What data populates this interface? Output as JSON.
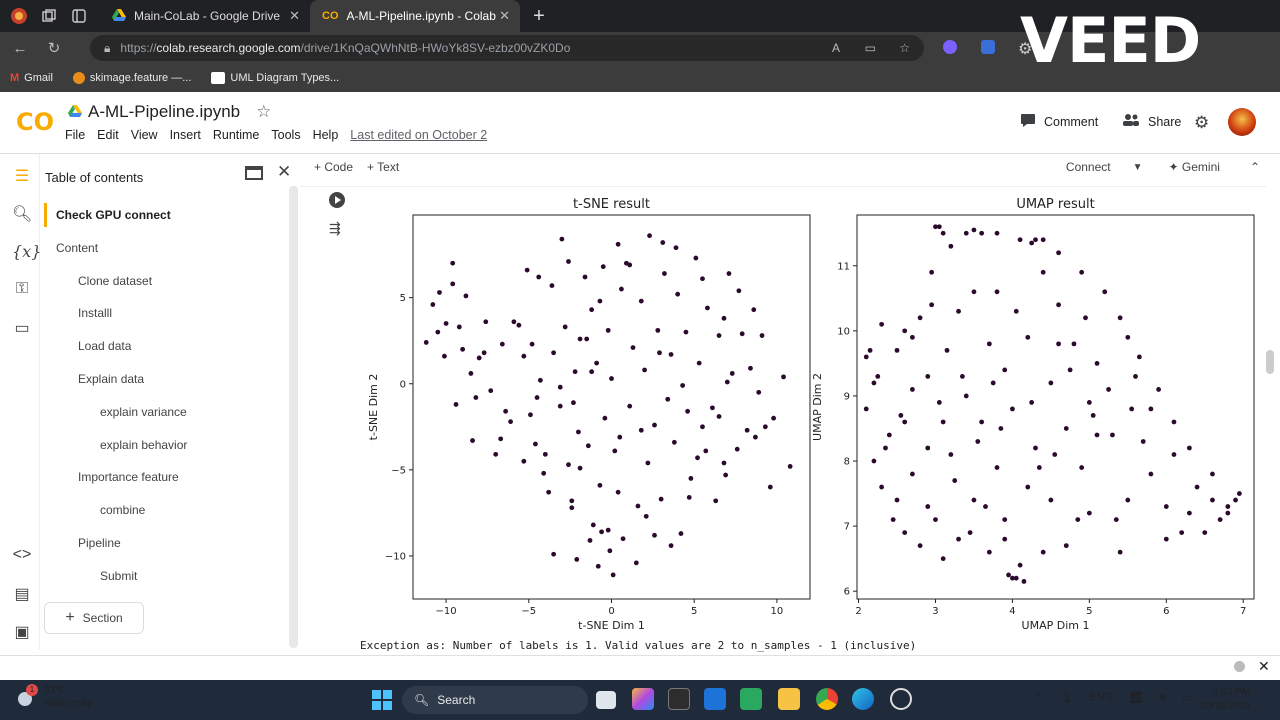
{
  "browser": {
    "tabs": [
      {
        "label": "Main-CoLab - Google Drive"
      },
      {
        "label": "A-ML-Pipeline.ipynb - Colab"
      }
    ],
    "url_prefix": "https://",
    "url_domain": "colab.research.google.com",
    "url_path": "/drive/1KnQaQWhNtB-HWoYk8SV-ezbz00vZK0Do",
    "bookmarks": [
      {
        "label": "Gmail"
      },
      {
        "label": "skimage.feature —..."
      },
      {
        "label": "UML Diagram Types..."
      }
    ],
    "watermark": "VEED"
  },
  "colab": {
    "logo": "CO",
    "notebook_title": "A-ML-Pipeline.ipynb",
    "menus": [
      "File",
      "Edit",
      "View",
      "Insert",
      "Runtime",
      "Tools",
      "Help"
    ],
    "last_edited": "Last edited on October 2",
    "comment_label": "Comment",
    "share_label": "Share",
    "toolbar": {
      "code_label": "Code",
      "text_label": "Text",
      "connect_label": "Connect",
      "gemini_label": "Gemini"
    }
  },
  "toc": {
    "title": "Table of contents",
    "items": [
      {
        "label": "Check GPU connect",
        "level": 1,
        "active": true
      },
      {
        "label": "Content",
        "level": 1
      },
      {
        "label": "Clone dataset",
        "level": 2
      },
      {
        "label": "Installl",
        "level": 2
      },
      {
        "label": "Load data",
        "level": 2
      },
      {
        "label": "Explain data",
        "level": 2
      },
      {
        "label": "explain variance",
        "level": 3
      },
      {
        "label": "explain behavior",
        "level": 3
      },
      {
        "label": "Importance feature",
        "level": 2
      },
      {
        "label": "combine",
        "level": 3
      },
      {
        "label": "Pipeline",
        "level": 2
      },
      {
        "label": "Submit",
        "level": 3
      }
    ],
    "section_button": "Section"
  },
  "output": {
    "exception": "Exception as: Number of labels is 1. Valid values are 2 to n_samples - 1 (inclusive)"
  },
  "chart_data": [
    {
      "type": "scatter",
      "title": "t-SNE result",
      "xlabel": "t-SNE Dim 1",
      "ylabel": "t-SNE Dim 2",
      "xlim": [
        -12,
        12
      ],
      "ylim": [
        -12.5,
        9.8
      ],
      "xticks": [
        -10,
        -5,
        0,
        5,
        10
      ],
      "yticks": [
        -10,
        -5,
        0,
        5
      ],
      "color": "#2c0a2e",
      "points": [
        [
          -11.2,
          2.4
        ],
        [
          -10.8,
          4.6
        ],
        [
          -10.5,
          3
        ],
        [
          -10.4,
          5.3
        ],
        [
          -10,
          3.5
        ],
        [
          -9.6,
          5.8
        ],
        [
          -9.6,
          7
        ],
        [
          -9.2,
          3.3
        ],
        [
          -9,
          2
        ],
        [
          -8.8,
          5.1
        ],
        [
          -8.5,
          0.6
        ],
        [
          -8.2,
          -0.8
        ],
        [
          -8,
          1.5
        ],
        [
          -7.6,
          3.6
        ],
        [
          -7.3,
          -0.4
        ],
        [
          -7,
          -4.1
        ],
        [
          -6.6,
          2.3
        ],
        [
          -6.1,
          -2.2
        ],
        [
          -5.9,
          3.6
        ],
        [
          -5.6,
          3.4
        ],
        [
          -5.3,
          1.6
        ],
        [
          -5.1,
          6.6
        ],
        [
          -4.9,
          -1.8
        ],
        [
          -4.6,
          -3.5
        ],
        [
          -4.3,
          0.2
        ],
        [
          -4.1,
          -5.2
        ],
        [
          -3.8,
          -6.3
        ],
        [
          -3.5,
          1.8
        ],
        [
          -3.1,
          -1.3
        ],
        [
          -3,
          8.4
        ],
        [
          -2.8,
          3.3
        ],
        [
          -2.6,
          -4.7
        ],
        [
          -2.4,
          -6.8
        ],
        [
          -2.2,
          0.7
        ],
        [
          -2,
          -2.8
        ],
        [
          -1.9,
          2.6
        ],
        [
          -1.6,
          6.2
        ],
        [
          -1.4,
          -3.6
        ],
        [
          -1.2,
          4.3
        ],
        [
          -1.1,
          -8.2
        ],
        [
          -0.9,
          1.2
        ],
        [
          -0.7,
          -5.9
        ],
        [
          -0.6,
          -8.6
        ],
        [
          -0.4,
          -2
        ],
        [
          -0.2,
          3.1
        ],
        [
          0,
          0.3
        ],
        [
          0.2,
          -3.9
        ],
        [
          0.4,
          -6.3
        ],
        [
          0.6,
          5.5
        ],
        [
          0.7,
          -9
        ],
        [
          0.9,
          7
        ],
        [
          1.1,
          -1.3
        ],
        [
          1.3,
          2.1
        ],
        [
          1.6,
          -7.1
        ],
        [
          1.8,
          4.8
        ],
        [
          2,
          0.8
        ],
        [
          2.2,
          -4.6
        ],
        [
          2.3,
          8.6
        ],
        [
          2.6,
          -2.4
        ],
        [
          2.8,
          3.1
        ],
        [
          3,
          -6.7
        ],
        [
          3.2,
          6.4
        ],
        [
          3.4,
          -0.9
        ],
        [
          3.6,
          1.7
        ],
        [
          3.8,
          -3.4
        ],
        [
          4,
          5.2
        ],
        [
          4.2,
          -8.7
        ],
        [
          4.3,
          -0.1
        ],
        [
          4.5,
          3
        ],
        [
          4.8,
          -5.5
        ],
        [
          5.1,
          7.3
        ],
        [
          5.3,
          1.2
        ],
        [
          5.5,
          -2.5
        ],
        [
          5.8,
          4.4
        ],
        [
          6.1,
          -1.4
        ],
        [
          6.3,
          -6.8
        ],
        [
          6.5,
          2.8
        ],
        [
          6.8,
          -4.6
        ],
        [
          7.1,
          6.4
        ],
        [
          7.3,
          0.6
        ],
        [
          7.6,
          -3.8
        ],
        [
          7.9,
          2.9
        ],
        [
          8.2,
          -2.7
        ],
        [
          8.6,
          4.3
        ],
        [
          8.9,
          -0.5
        ],
        [
          9.3,
          -2.5
        ],
        [
          9.6,
          -6
        ],
        [
          9.8,
          -2
        ],
        [
          10.4,
          0.4
        ],
        [
          10.8,
          -4.8
        ],
        [
          -9.4,
          -1.2
        ],
        [
          -3.5,
          -9.9
        ],
        [
          -2.1,
          -10.2
        ],
        [
          0.1,
          -11.1
        ],
        [
          1.5,
          -10.4
        ],
        [
          -0.8,
          -10.6
        ],
        [
          3.6,
          -9.4
        ],
        [
          2.6,
          -8.8
        ],
        [
          -1.3,
          -9.1
        ],
        [
          -0.1,
          -9.7
        ],
        [
          5.7,
          -3.9
        ],
        [
          4.7,
          -6.6
        ],
        [
          6.9,
          -5.3
        ],
        [
          8.4,
          0.9
        ],
        [
          -6.7,
          -3.2
        ],
        [
          -4.5,
          -0.8
        ],
        [
          -2.3,
          -1.1
        ],
        [
          -3.6,
          5.7
        ],
        [
          -1.9,
          -4.9
        ],
        [
          -0.7,
          4.8
        ],
        [
          1.1,
          6.9
        ],
        [
          3.1,
          8.2
        ],
        [
          -5.3,
          -4.5
        ],
        [
          -4,
          -4.1
        ],
        [
          -1.5,
          2.6
        ],
        [
          1.8,
          -2.7
        ],
        [
          0.5,
          -3.1
        ],
        [
          -3.1,
          -0.2
        ],
        [
          5.5,
          6.1
        ],
        [
          7,
          0.1
        ],
        [
          6.5,
          -1.9
        ],
        [
          -7.7,
          1.8
        ],
        [
          -8.4,
          -3.3
        ],
        [
          -10.1,
          1.6
        ],
        [
          -6.4,
          -1.6
        ],
        [
          -4.8,
          2.3
        ],
        [
          -2.4,
          -7.2
        ],
        [
          -0.2,
          -8.5
        ],
        [
          2.1,
          -7.7
        ],
        [
          -1.2,
          0.7
        ],
        [
          2.9,
          1.8
        ],
        [
          4.6,
          -1.6
        ],
        [
          5.2,
          -4.3
        ],
        [
          8.7,
          -3.1
        ],
        [
          9.1,
          2.8
        ],
        [
          7.7,
          5.4
        ],
        [
          6.8,
          3.8
        ],
        [
          3.9,
          7.9
        ],
        [
          0.4,
          8.1
        ],
        [
          -2.6,
          7.1
        ],
        [
          -4.4,
          6.2
        ],
        [
          -0.5,
          6.8
        ]
      ]
    },
    {
      "type": "scatter",
      "title": "UMAP result",
      "xlabel": "UMAP Dim 1",
      "ylabel": "UMAP Dim 2",
      "xlim": [
        1.98,
        7.14
      ],
      "ylim": [
        5.88,
        11.78
      ],
      "xticks": [
        2,
        3,
        4,
        5,
        6,
        7
      ],
      "yticks": [
        6,
        7,
        8,
        9,
        10,
        11
      ],
      "color": "#2c0a2e",
      "points": [
        [
          2.1,
          9.6
        ],
        [
          2.1,
          8.8
        ],
        [
          2.2,
          9.2
        ],
        [
          2.2,
          8
        ],
        [
          2.3,
          10.1
        ],
        [
          2.3,
          7.6
        ],
        [
          2.4,
          8.4
        ],
        [
          2.5,
          9.7
        ],
        [
          2.5,
          7.4
        ],
        [
          2.6,
          8.6
        ],
        [
          2.6,
          6.9
        ],
        [
          2.7,
          9.1
        ],
        [
          2.7,
          7.8
        ],
        [
          2.8,
          10.2
        ],
        [
          2.8,
          6.7
        ],
        [
          2.9,
          9.3
        ],
        [
          2.9,
          8.2
        ],
        [
          2.95,
          10.9
        ],
        [
          3,
          11.6
        ],
        [
          3,
          7.1
        ],
        [
          3.05,
          8.9
        ],
        [
          3.1,
          11.5
        ],
        [
          3.1,
          6.5
        ],
        [
          3.15,
          9.7
        ],
        [
          3.2,
          11.3
        ],
        [
          3.2,
          8.1
        ],
        [
          3.3,
          10.3
        ],
        [
          3.3,
          6.8
        ],
        [
          3.4,
          11.5
        ],
        [
          3.4,
          9
        ],
        [
          3.5,
          7.4
        ],
        [
          3.5,
          10.6
        ],
        [
          3.6,
          8.6
        ],
        [
          3.6,
          11.5
        ],
        [
          3.7,
          6.6
        ],
        [
          3.7,
          9.8
        ],
        [
          3.8,
          7.9
        ],
        [
          3.8,
          11.5
        ],
        [
          3.9,
          9.4
        ],
        [
          3.9,
          7.1
        ],
        [
          4,
          6.2
        ],
        [
          4,
          8.8
        ],
        [
          4.05,
          10.3
        ],
        [
          4.1,
          11.4
        ],
        [
          4.1,
          6.4
        ],
        [
          4.2,
          7.6
        ],
        [
          4.2,
          9.9
        ],
        [
          4.3,
          11.4
        ],
        [
          4.3,
          8.2
        ],
        [
          4.4,
          6.6
        ],
        [
          4.4,
          11.4
        ],
        [
          4.5,
          9.2
        ],
        [
          4.5,
          7.4
        ],
        [
          4.6,
          10.4
        ],
        [
          4.6,
          11.2
        ],
        [
          4.7,
          8.5
        ],
        [
          4.7,
          6.7
        ],
        [
          4.8,
          9.8
        ],
        [
          4.9,
          7.9
        ],
        [
          4.9,
          10.9
        ],
        [
          5,
          8.9
        ],
        [
          5,
          7.2
        ],
        [
          5.1,
          9.5
        ],
        [
          5.2,
          10.6
        ],
        [
          5.3,
          8.4
        ],
        [
          5.4,
          6.6
        ],
        [
          5.5,
          9.9
        ],
        [
          5.5,
          7.4
        ],
        [
          5.6,
          9.3
        ],
        [
          5.7,
          8.3
        ],
        [
          5.8,
          7.8
        ],
        [
          5.9,
          9.1
        ],
        [
          6,
          7.3
        ],
        [
          6,
          6.8
        ],
        [
          6.1,
          8.6
        ],
        [
          6.2,
          6.9
        ],
        [
          6.3,
          7.2
        ],
        [
          6.4,
          7.6
        ],
        [
          6.5,
          6.9
        ],
        [
          6.6,
          7.4
        ],
        [
          6.7,
          7.1
        ],
        [
          6.8,
          7.3
        ],
        [
          6.9,
          7.4
        ],
        [
          6.95,
          7.5
        ],
        [
          6.8,
          7.2
        ],
        [
          6.6,
          7.8
        ],
        [
          6.3,
          8.2
        ],
        [
          6.1,
          8.1
        ],
        [
          5.8,
          8.8
        ],
        [
          4.15,
          6.15
        ],
        [
          3.95,
          6.25
        ],
        [
          4.05,
          6.2
        ],
        [
          2.15,
          9.7
        ],
        [
          2.6,
          10
        ],
        [
          2.35,
          8.2
        ],
        [
          2.9,
          7.3
        ],
        [
          3.1,
          8.6
        ],
        [
          3.35,
          9.3
        ],
        [
          3.55,
          8.3
        ],
        [
          3.75,
          9.2
        ],
        [
          3.85,
          8.5
        ],
        [
          4.25,
          8.9
        ],
        [
          4.35,
          7.9
        ],
        [
          4.55,
          8.1
        ],
        [
          4.75,
          9.4
        ],
        [
          4.85,
          7.1
        ],
        [
          5.05,
          8.7
        ],
        [
          5.25,
          9.1
        ],
        [
          5.35,
          7.1
        ],
        [
          5.55,
          8.8
        ],
        [
          5.65,
          9.6
        ],
        [
          3.25,
          7.7
        ],
        [
          3.45,
          6.9
        ],
        [
          3.65,
          7.3
        ],
        [
          3.9,
          6.8
        ],
        [
          4.6,
          9.8
        ],
        [
          4.4,
          10.9
        ],
        [
          4.25,
          11.35
        ],
        [
          3.5,
          11.55
        ],
        [
          3.05,
          11.6
        ],
        [
          2.95,
          10.4
        ],
        [
          2.7,
          9.9
        ],
        [
          2.45,
          7.1
        ],
        [
          2.25,
          9.3
        ],
        [
          5.4,
          10.2
        ],
        [
          5.1,
          8.4
        ],
        [
          4.95,
          10.2
        ],
        [
          3.8,
          10.6
        ],
        [
          2.55,
          8.7
        ]
      ]
    }
  ],
  "taskbar": {
    "temperature": "33°C",
    "weather_text": "Nhiều mây",
    "weather_badge": "1",
    "search_label": "Search",
    "lang": "ENG",
    "time": "4:03 PM",
    "date": "10/10/2024"
  }
}
